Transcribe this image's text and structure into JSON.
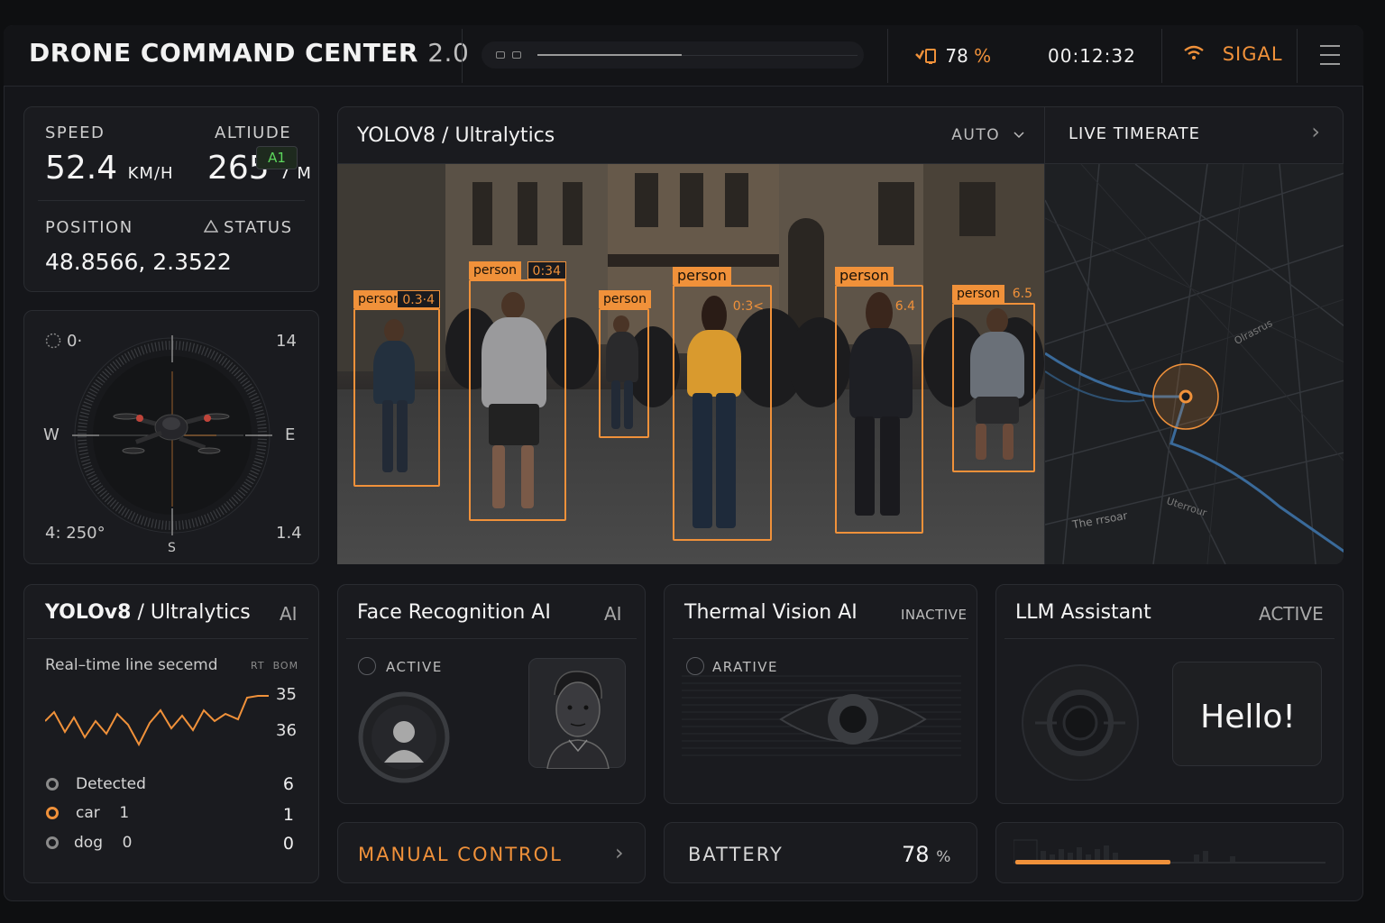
{
  "header": {
    "title": "DRONE COMMAND CENTER",
    "version": "2.0",
    "battery_icon": "battery-icon",
    "battery_value": "78",
    "battery_unit": "%",
    "timer": "00:12:32",
    "signal_icon": "wifi-icon",
    "signal_label": "SIGAL",
    "menu_icon": "hamburger-menu-icon"
  },
  "telemetry": {
    "speed_label": "SPEED",
    "speed_value": "52.4",
    "speed_unit": "KM/H",
    "altitude_label": "ALTIUDE",
    "altitude_value": "265",
    "altitude_unit": "7 M",
    "position_label": "POSITION",
    "position_value": "48.8566, 2.3522",
    "status_label": "STATUS",
    "status_badge": "A1"
  },
  "compass": {
    "top_left": "0·",
    "top_right": "14",
    "west": "W",
    "east": "E",
    "south": "S",
    "bottom_left": "4: 250°",
    "bottom_right": "1.4"
  },
  "feed": {
    "model": "YOLOV8",
    "sep": "/",
    "provider": "Ultralytics",
    "mode": "AUTO",
    "detections": [
      {
        "label": "person",
        "conf": "0.3·4"
      },
      {
        "label": "person",
        "conf": "0:34"
      },
      {
        "label": "person",
        "conf": ""
      },
      {
        "label": "person",
        "conf": "0:3<"
      },
      {
        "label": "person",
        "conf": "6.4"
      },
      {
        "label": "person",
        "conf": "6.5"
      }
    ]
  },
  "map": {
    "title": "LIVE TIMERATE",
    "chevron": "›",
    "labels": [
      "The rrsoar",
      "Uterrour",
      "Olrasrus"
    ]
  },
  "yolo_panel": {
    "model": "YOLOv8",
    "sep": "/",
    "provider": "Ultralytics",
    "tag": "AI",
    "subtitle": "Real–time line secemd",
    "rt_label": "RT",
    "bom_label": "BOM",
    "y_top": "35",
    "y_bottom": "36",
    "legend": [
      {
        "name": "Detected",
        "count": "",
        "value": "6",
        "color": "#8a8a8a"
      },
      {
        "name": "car",
        "count": "1",
        "value": "1",
        "color": "#f0913a"
      },
      {
        "name": "dog",
        "count": "0",
        "value": "0",
        "color": "#8a8a8a"
      }
    ]
  },
  "face": {
    "title": "Face Recognition AI",
    "tag": "AI",
    "status": "ACTIVE"
  },
  "thermal": {
    "title": "Thermal Vision AI",
    "tag": "INACTIVE",
    "status": "ARATIVE"
  },
  "llm": {
    "title": "LLM Assistant",
    "tag": "ACTIVE",
    "message": "Hello!"
  },
  "footer": {
    "manual_label": "MANUAL CONTROL",
    "manual_chevron": "›",
    "battery_label": "BATTERY",
    "battery_value": "78",
    "battery_unit": "%"
  },
  "colors": {
    "accent": "#f0913a",
    "status_green": "#5cd65c",
    "route_blue": "#3a6a9a"
  }
}
